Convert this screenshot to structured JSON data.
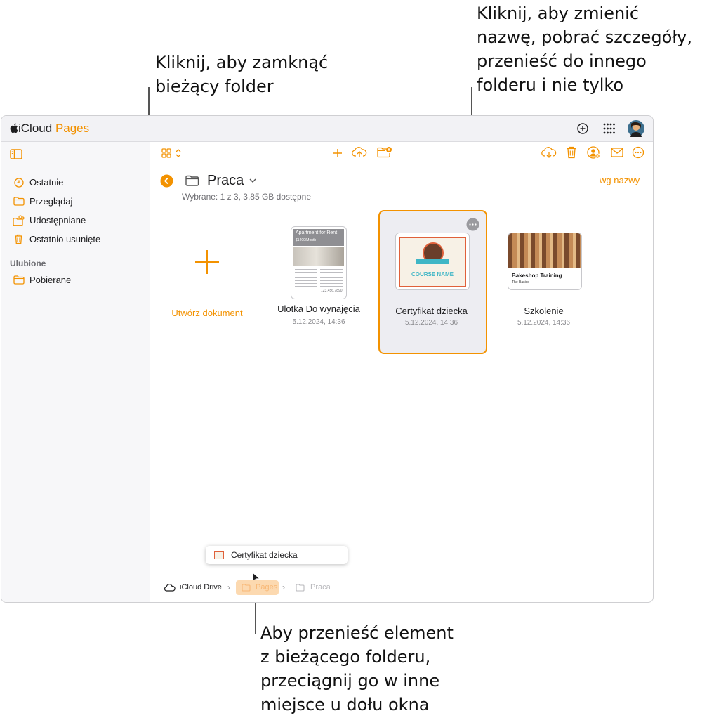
{
  "callouts": {
    "close_folder": "Kliknij, aby zamknąć\nbieżący folder",
    "rename": "Kliknij, aby zmienić\nnazwę, pobrać szczegóły,\nprzenieść do innego\nfolderu i nie tylko",
    "move": "Aby przenieść element\nz bieżącego folderu,\nprzeciągnij go w inne\nmiejsce u dołu okna"
  },
  "app": {
    "brand_prefix": "iCloud",
    "brand_name": "Pages"
  },
  "sidebar": {
    "items": [
      {
        "label": "Ostatnie",
        "icon": "clock-icon"
      },
      {
        "label": "Przeglądaj",
        "icon": "folder-icon"
      },
      {
        "label": "Udostępniane",
        "icon": "shared-folder-icon"
      },
      {
        "label": "Ostatnio usunięte",
        "icon": "trash-icon"
      }
    ],
    "favorites_heading": "Ulubione",
    "favorites": [
      {
        "label": "Pobierane",
        "icon": "folder-icon"
      }
    ]
  },
  "folder": {
    "name": "Praca",
    "status": "Wybrane: 1 z 3, 3,85 GB dostępne",
    "sort_label": "wg nazwy"
  },
  "create": {
    "label": "Utwórz dokument"
  },
  "documents": [
    {
      "title": "Ulotka Do wynajęcia",
      "date": "5.12.2024, 14:36",
      "thumb_heading": "Apartment for Rent",
      "thumb_price": "$1400/Month",
      "thumb_phone": "123.456.7890"
    },
    {
      "title": "Certyfikat dziecka",
      "date": "5.12.2024, 14:36",
      "thumb_text": "COURSE NAME",
      "selected": true
    },
    {
      "title": "Szkolenie",
      "date": "5.12.2024, 14:36",
      "thumb_heading": "Bakeshop Training",
      "thumb_sub": "The Basics"
    }
  ],
  "drag": {
    "label": "Certyfikat dziecka"
  },
  "breadcrumb": {
    "items": [
      "iCloud Drive",
      "Pages",
      "Praca"
    ]
  },
  "colors": {
    "accent": "#f39200",
    "selection_bg": "#ededf2",
    "cert_border": "#e0603a",
    "cert_teal": "#3fb6c6"
  }
}
